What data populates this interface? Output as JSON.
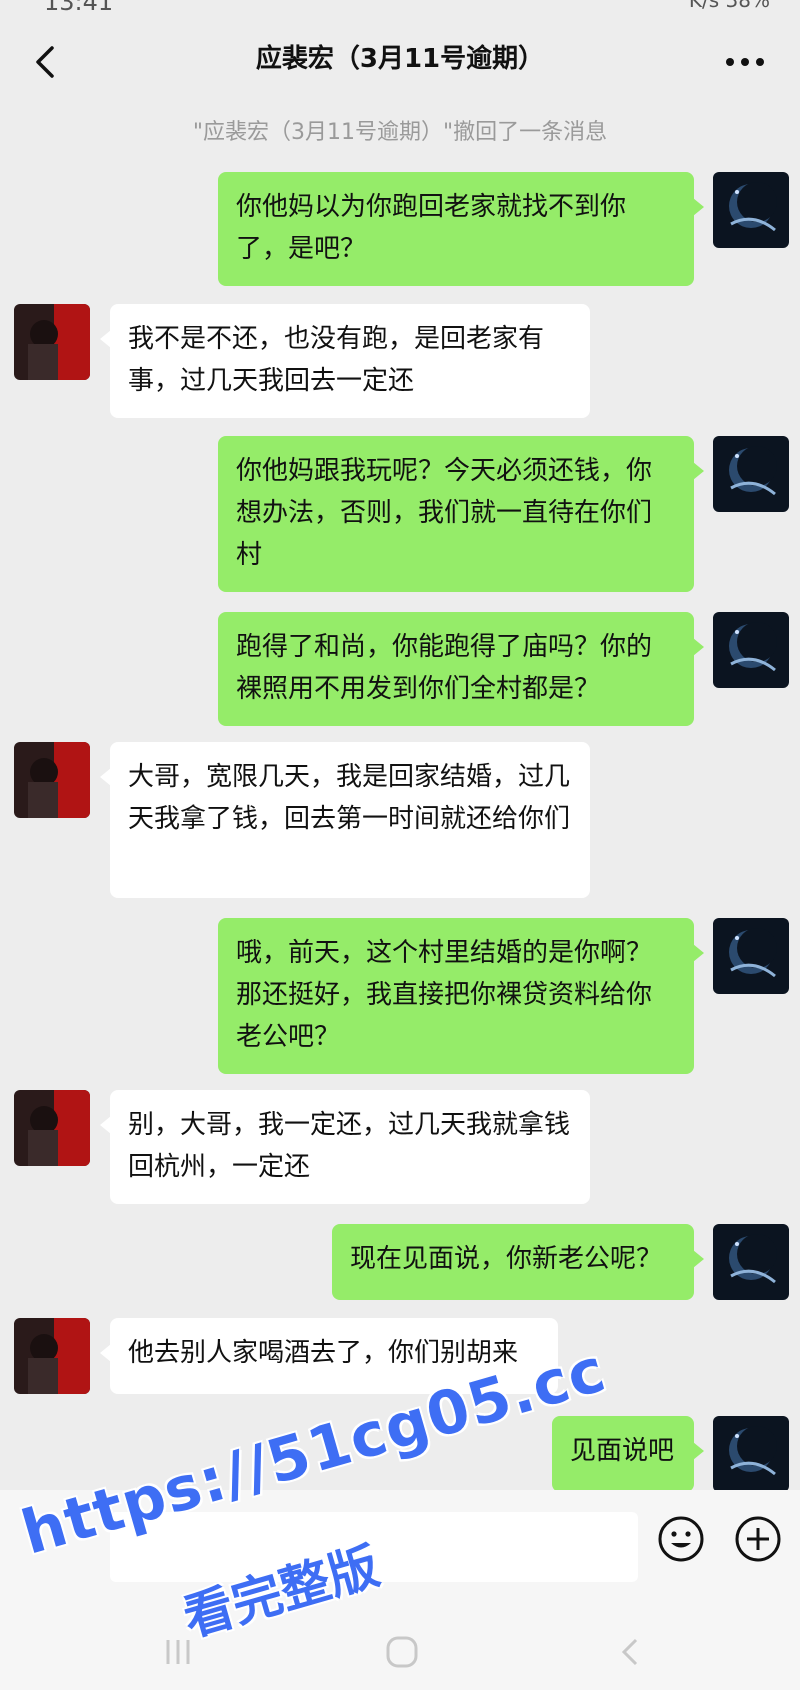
{
  "status": {
    "time": "13:41",
    "right": "K/s 38%"
  },
  "header": {
    "title": "应裴宏（3月11号逾期）"
  },
  "system": {
    "recall_notice": "\"应裴宏（3月11号逾期）\"撤回了一条消息"
  },
  "messages": [
    {
      "direction": "out",
      "text": "你他妈以为你跑回老家就找不到你了，是吧？"
    },
    {
      "direction": "in",
      "text": "我不是不还，也没有跑，是回老家有事，过几天我回去一定还"
    },
    {
      "direction": "out",
      "text": "你他妈跟我玩呢？今天必须还钱，你想办法，否则，我们就一直待在你们村"
    },
    {
      "direction": "out",
      "text": "跑得了和尚，你能跑得了庙吗？你的裸照用不用发到你们全村都是？"
    },
    {
      "direction": "in",
      "text": "大哥，宽限几天，我是回家结婚，过几天我拿了钱，回去第一时间就还给你们"
    },
    {
      "direction": "out",
      "text": "哦，前天，这个村里结婚的是你啊？那还挺好，我直接把你裸贷资料给你老公吧？"
    },
    {
      "direction": "in",
      "text": "别，大哥，我一定还，过几天我就拿钱回杭州，一定还"
    },
    {
      "direction": "out",
      "text": "现在见面说，你新老公呢？"
    },
    {
      "direction": "in",
      "text": "他去别人家喝酒去了，你们别胡来"
    },
    {
      "direction": "out",
      "text": "见面说吧"
    }
  ],
  "input": {
    "placeholder": ""
  },
  "watermark": {
    "line1": "https://51cg05.cc",
    "line2": "看完整版"
  },
  "colors": {
    "outgoing_bubble": "#95ec69",
    "incoming_bubble": "#ffffff",
    "background": "#ededed",
    "watermark": "#3e6ef4"
  },
  "icons": [
    "back-arrow-icon",
    "more-dots-icon",
    "emoji-icon",
    "plus-icon",
    "nav-recent-icon",
    "nav-home-icon",
    "nav-back-icon"
  ]
}
